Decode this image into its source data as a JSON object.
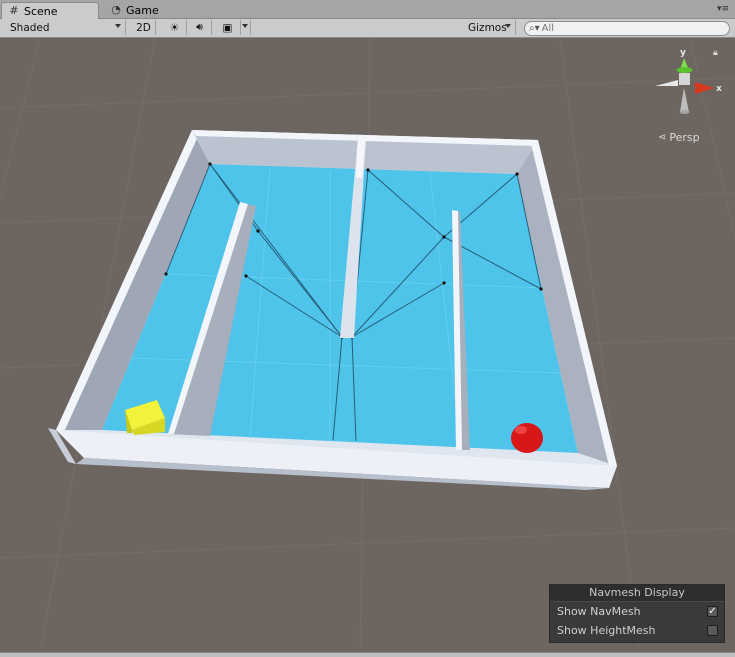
{
  "tabs": [
    {
      "label": "Scene",
      "icon": "grid-icon",
      "active": true
    },
    {
      "label": "Game",
      "icon": "pacman-icon",
      "active": false
    }
  ],
  "toolbar": {
    "shading_mode": "Shaded",
    "mode_2d": "2D",
    "gizmos_label": "Gizmos",
    "search_placeholder": "All"
  },
  "orientation_gizmo": {
    "y_label": "y",
    "x_label": "x",
    "projection_label": "Persp"
  },
  "navmesh_display": {
    "title": "Navmesh Display",
    "options": [
      {
        "label": "Show NavMesh",
        "checked": true
      },
      {
        "label": "Show HeightMesh",
        "checked": false
      }
    ]
  },
  "colors": {
    "viewport_bg": "#6d6560",
    "navmesh_blue": "#4ec4ea",
    "wall": "#e6ecf5",
    "agent_red": "#d81818",
    "cube_yellow": "#e0e020"
  }
}
